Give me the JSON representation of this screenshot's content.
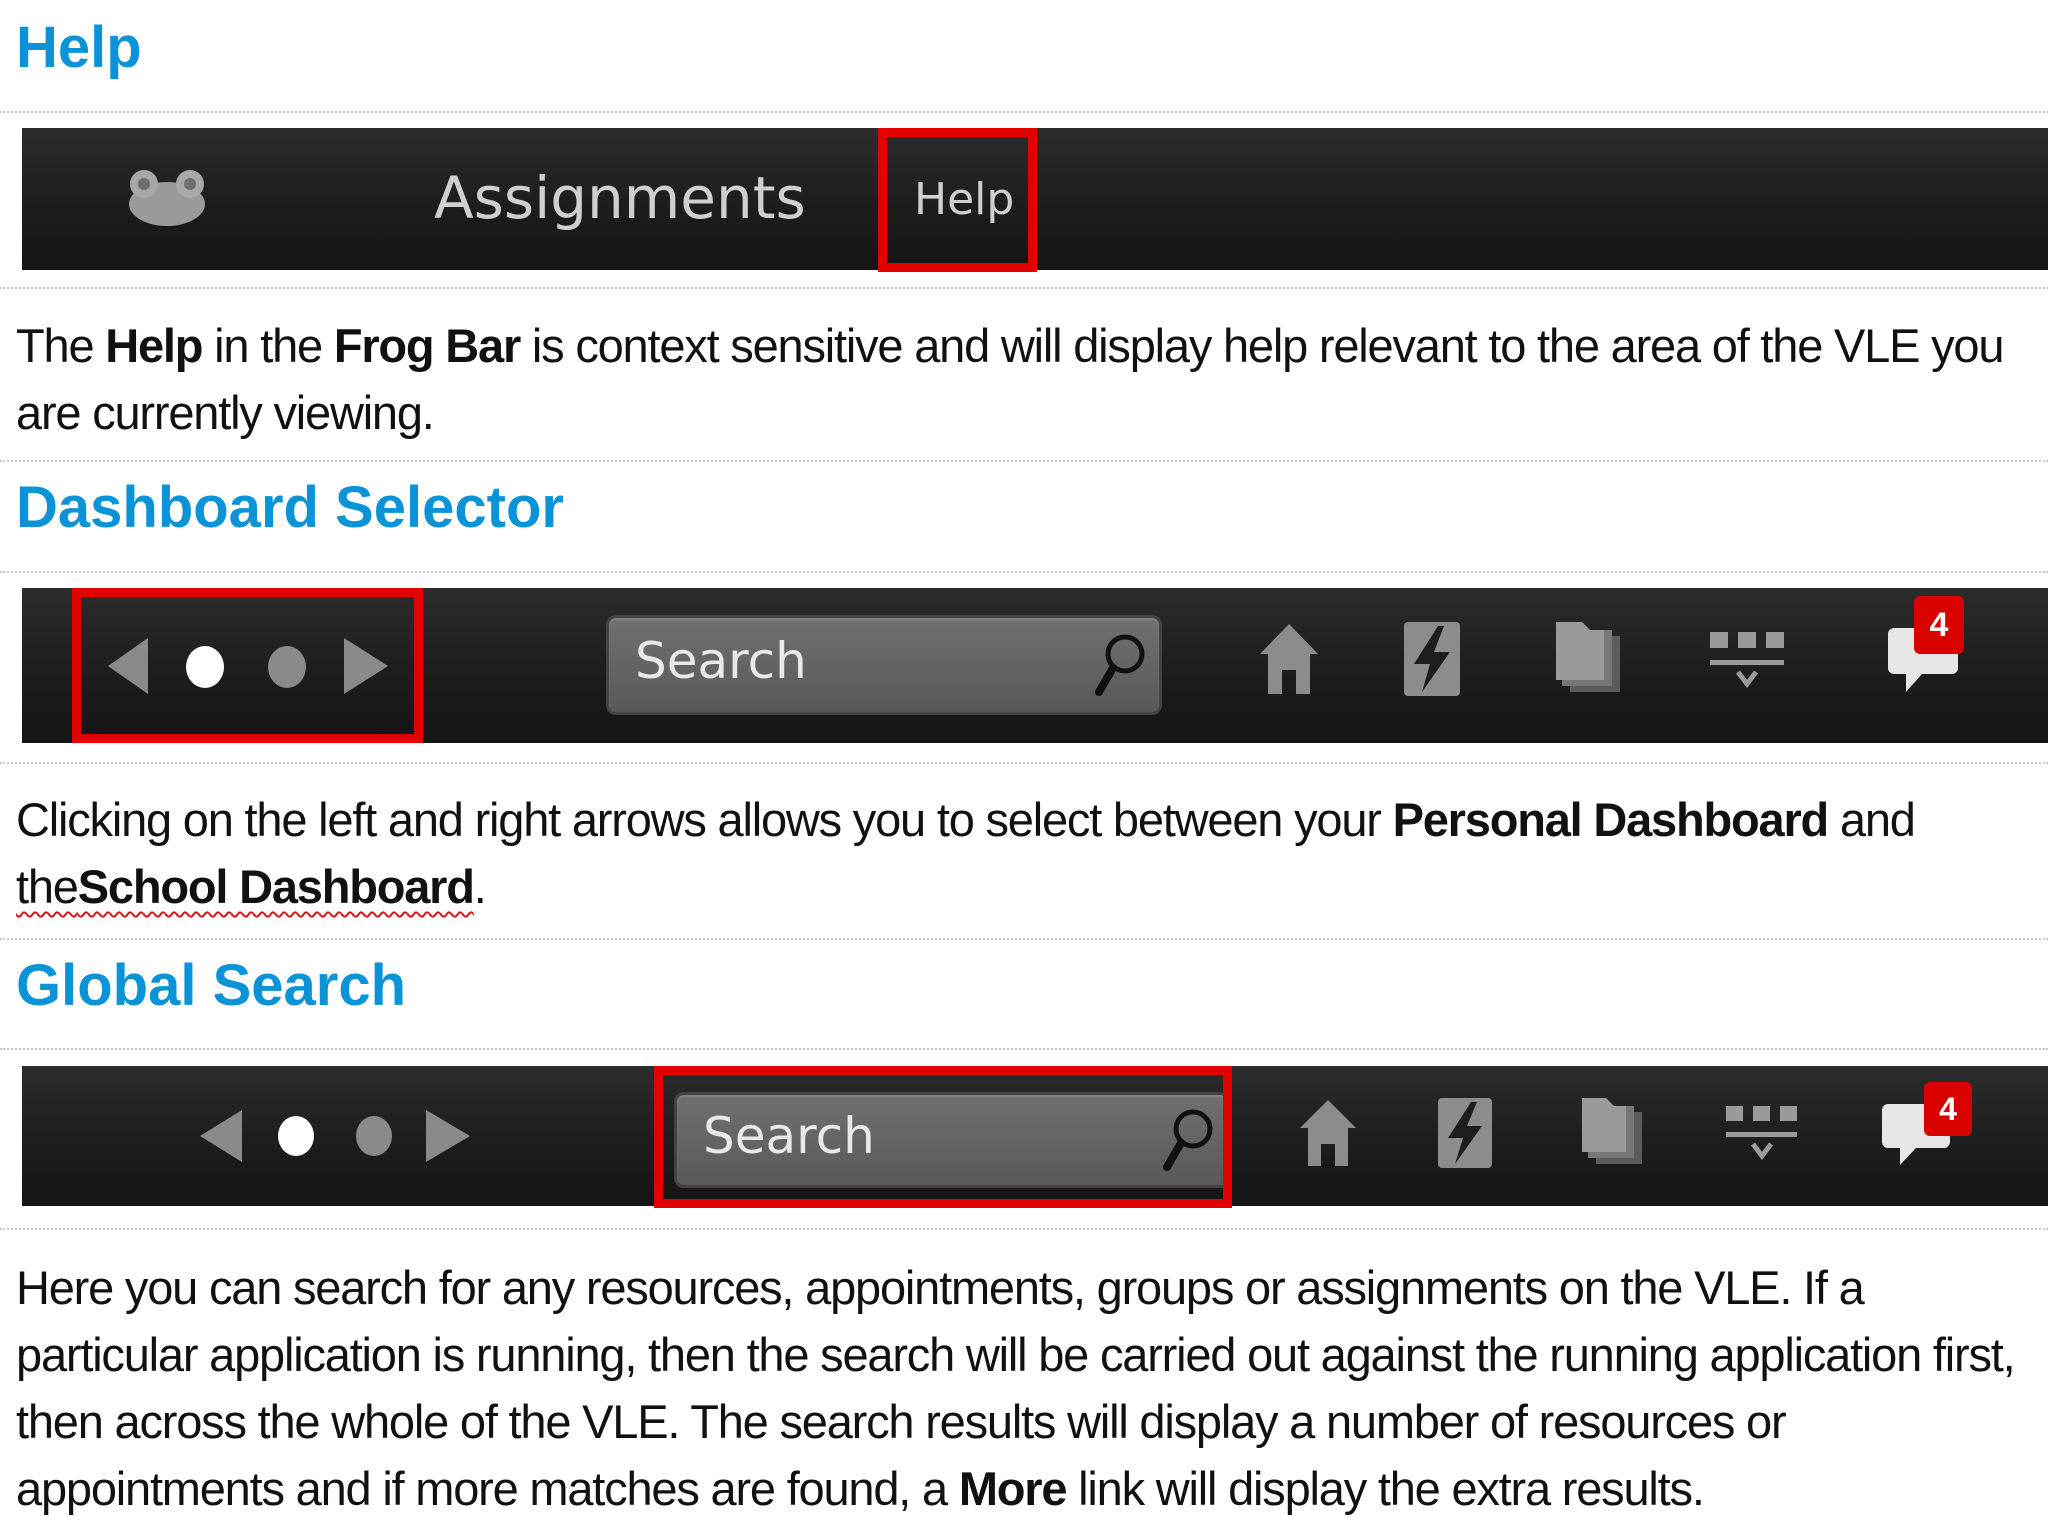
{
  "help_section": {
    "heading": "Help",
    "frogbar": {
      "logo": "frog-logo-icon",
      "assignments_label": "Assignments",
      "help_label": "Help"
    },
    "text": {
      "p1": "The ",
      "b1": "Help",
      "p2": " in the ",
      "b2": "Frog Bar",
      "p3": " is context sensitive and will display help relevant to the area of the VLE you are currently viewing."
    }
  },
  "dashboard_section": {
    "heading": "Dashboard Selector",
    "search_placeholder": "Search",
    "badge_count": "4",
    "icons": [
      "arrow-left-icon",
      "dot-active-icon",
      "dot-icon",
      "arrow-right-icon",
      "search-icon",
      "home-icon",
      "lightning-icon",
      "files-icon",
      "apps-icon",
      "chat-icon"
    ],
    "text": {
      "p1": "Clicking on the left and right arrows allows you to select between your ",
      "b1": "Personal Dashboard",
      "p2": " and ",
      "p3": "the",
      "b2": "School Dashboard",
      "p4": "."
    }
  },
  "search_section": {
    "heading": "Global Search",
    "search_placeholder": "Search",
    "badge_count": "4",
    "text": {
      "p1": "Here you can search for any resources, appointments, groups or assignments on the VLE. If a particular application is running, then the search will be carried out against the running application first, then across the whole of the VLE. The search results will display a number of resources or appointments and if more matches are found, a ",
      "b1": "More",
      "p2": " link will display the extra results."
    }
  },
  "colors": {
    "heading": "#0a93d6",
    "highlight": "#e30000",
    "bar": "#1e1e1e",
    "badge": "#d90000"
  }
}
